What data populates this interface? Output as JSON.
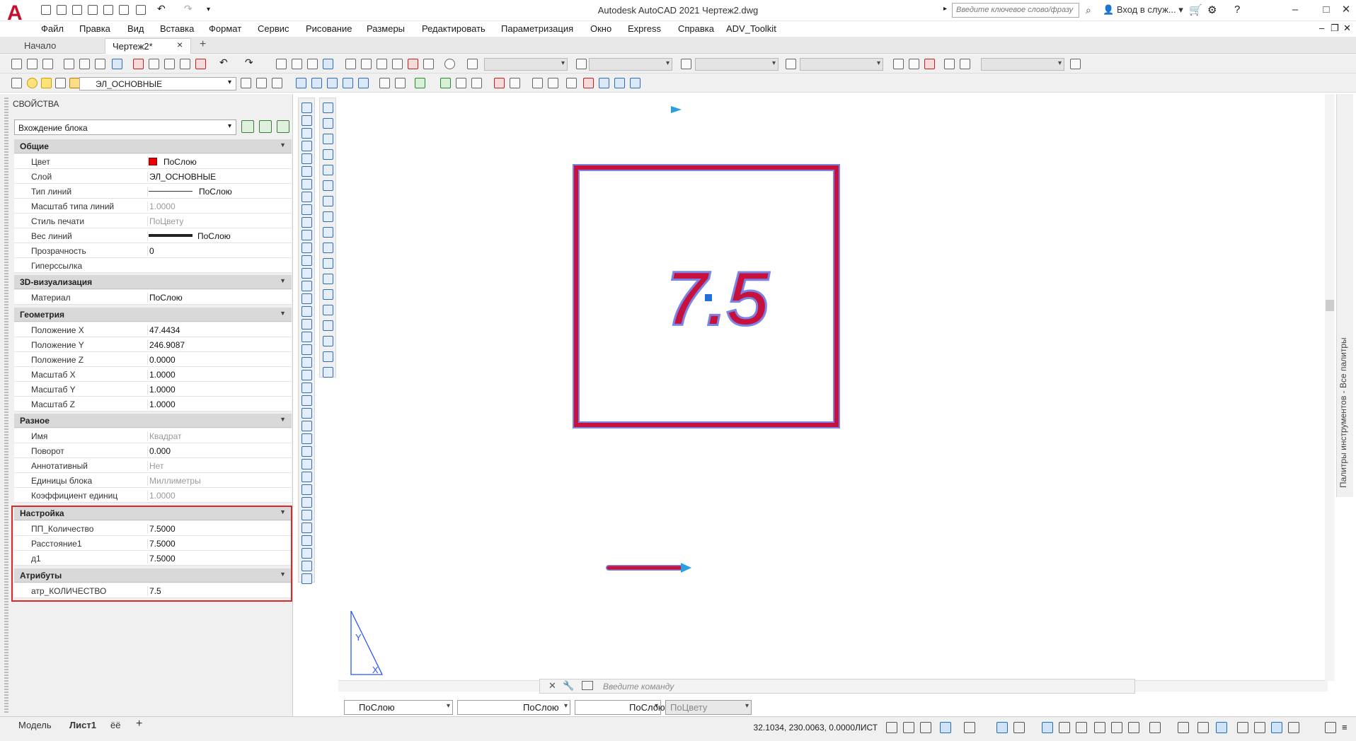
{
  "window": {
    "title": "Autodesk AutoCAD 2021    Чертеж2.dwg",
    "search_placeholder": "Введите ключевое слово/фразу",
    "signin_label": "Вход в служ...",
    "logo_letter": "A"
  },
  "menu": [
    "Файл",
    "Правка",
    "Вид",
    "Вставка",
    "Формат",
    "Сервис",
    "Рисование",
    "Размеры",
    "Редактировать",
    "Параметризация",
    "Окно",
    "Express",
    "Справка",
    "ADV_Toolkit"
  ],
  "tabs": {
    "start": "Начало",
    "drawing": "Чертеж2*",
    "close": "×",
    "add": "+"
  },
  "layer_toolbar": {
    "layer_name": "ЭЛ_ОСНОВНЫЕ",
    "layer_color": "#e00000"
  },
  "properties": {
    "title": "СВОЙСТВА",
    "object_type": "Вхождение блока",
    "categories": {
      "general": "Общие",
      "viz3d": "3D-визуализация",
      "geometry": "Геометрия",
      "misc": "Разное",
      "custom": "Настройка",
      "attributes": "Атрибуты"
    },
    "general": [
      {
        "label": "Цвет",
        "value": "ПоСлою"
      },
      {
        "label": "Слой",
        "value": "ЭЛ_ОСНОВНЫЕ"
      },
      {
        "label": "Тип линий",
        "value": "ПоСлою"
      },
      {
        "label": "Масштаб типа линий",
        "value": "1.0000"
      },
      {
        "label": "Стиль печати",
        "value": "ПоЦвету"
      },
      {
        "label": "Вес линий",
        "value": "ПоСлою"
      },
      {
        "label": "Прозрачность",
        "value": "0"
      },
      {
        "label": "Гиперссылка",
        "value": ""
      }
    ],
    "viz3d": [
      {
        "label": "Материал",
        "value": "ПоСлою"
      }
    ],
    "geometry": [
      {
        "label": "Положение X",
        "value": "47.4434"
      },
      {
        "label": "Положение Y",
        "value": "246.9087"
      },
      {
        "label": "Положение Z",
        "value": "0.0000"
      },
      {
        "label": "Масштаб X",
        "value": "1.0000"
      },
      {
        "label": "Масштаб Y",
        "value": "1.0000"
      },
      {
        "label": "Масштаб Z",
        "value": "1.0000"
      }
    ],
    "misc": [
      {
        "label": "Имя",
        "value": "Квадрат"
      },
      {
        "label": "Поворот",
        "value": "0.000"
      },
      {
        "label": "Аннотативный",
        "value": "Нет"
      },
      {
        "label": "Единицы блока",
        "value": "Миллиметры"
      },
      {
        "label": "Коэффициент единиц",
        "value": "1.0000"
      }
    ],
    "custom": [
      {
        "label": "ПП_Количество",
        "value": "7.5000"
      },
      {
        "label": "Расстояние1",
        "value": "7.5000"
      },
      {
        "label": "д1",
        "value": "7.5000"
      }
    ],
    "attributes": [
      {
        "label": "атр_КОЛИЧЕСТВО",
        "value": "7.5"
      }
    ]
  },
  "drawing": {
    "attribute_text": "7.5",
    "outline_color": "#c8103c",
    "glow_color": "#6a7ae0"
  },
  "command_line": {
    "placeholder": "Введите команду"
  },
  "property_bar": {
    "color": "ПоСлою",
    "linetype": "ПоСлою",
    "lineweight": "ПоСлою",
    "plotstyle": "ПоЦвету"
  },
  "side_palette": {
    "label": "Палитры инструментов - Все палитры"
  },
  "status": {
    "layout_tabs": [
      "Модель",
      "Лист1",
      "ёё"
    ],
    "add_tab": "+",
    "coordinates": "32.1034, 230.0063, 0.0000",
    "space": "ЛИСТ"
  }
}
